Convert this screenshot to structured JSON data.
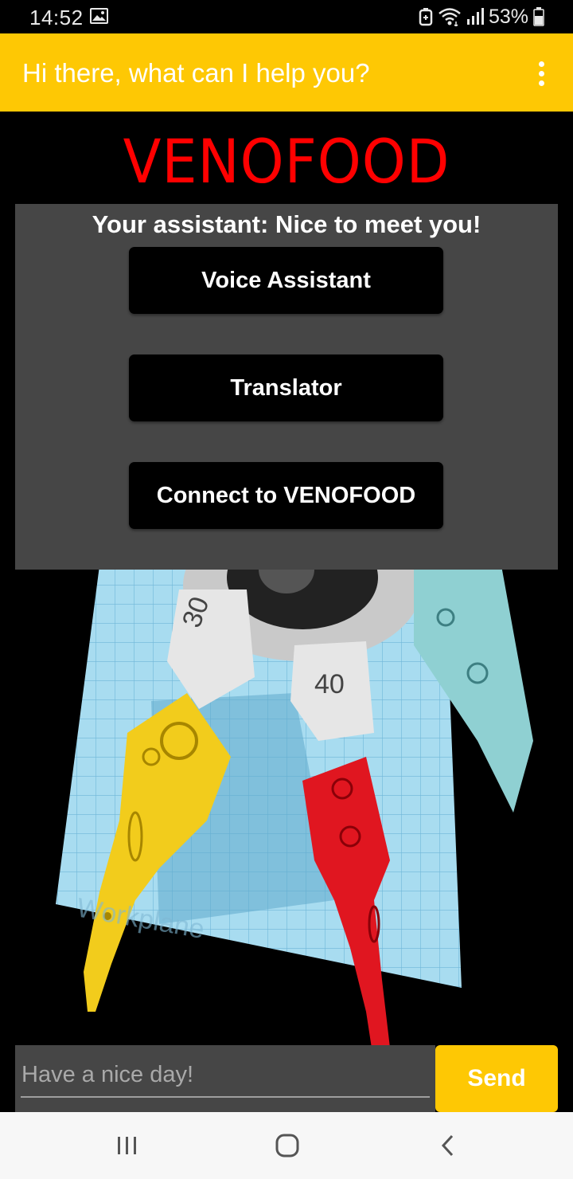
{
  "status_bar": {
    "time": "14:52",
    "battery_percent": "53%",
    "icons": [
      "gallery-icon",
      "data-saver-icon",
      "wifi-icon",
      "signal-icon",
      "battery-icon"
    ]
  },
  "app_bar": {
    "title": "Hi there, what can I help you?",
    "menu_icon": "overflow-menu-icon",
    "background": "#fec804"
  },
  "brand": {
    "title": "VENOFOOD",
    "color": "#ff0000"
  },
  "assistant_panel": {
    "message": "Your assistant: Nice to meet you!",
    "buttons": [
      {
        "label": "Voice Assistant"
      },
      {
        "label": "Translator"
      },
      {
        "label": "Connect to VENOFOOD"
      }
    ],
    "background": "#464646"
  },
  "robot_image": {
    "part_labels": [
      "30",
      "40"
    ],
    "workplane_label": "Workplane"
  },
  "chat_input": {
    "placeholder": "Have a nice day!",
    "value": "",
    "send_label": "Send"
  },
  "nav_bar": {
    "icons": [
      "recent-apps-icon",
      "home-icon",
      "back-icon"
    ]
  }
}
